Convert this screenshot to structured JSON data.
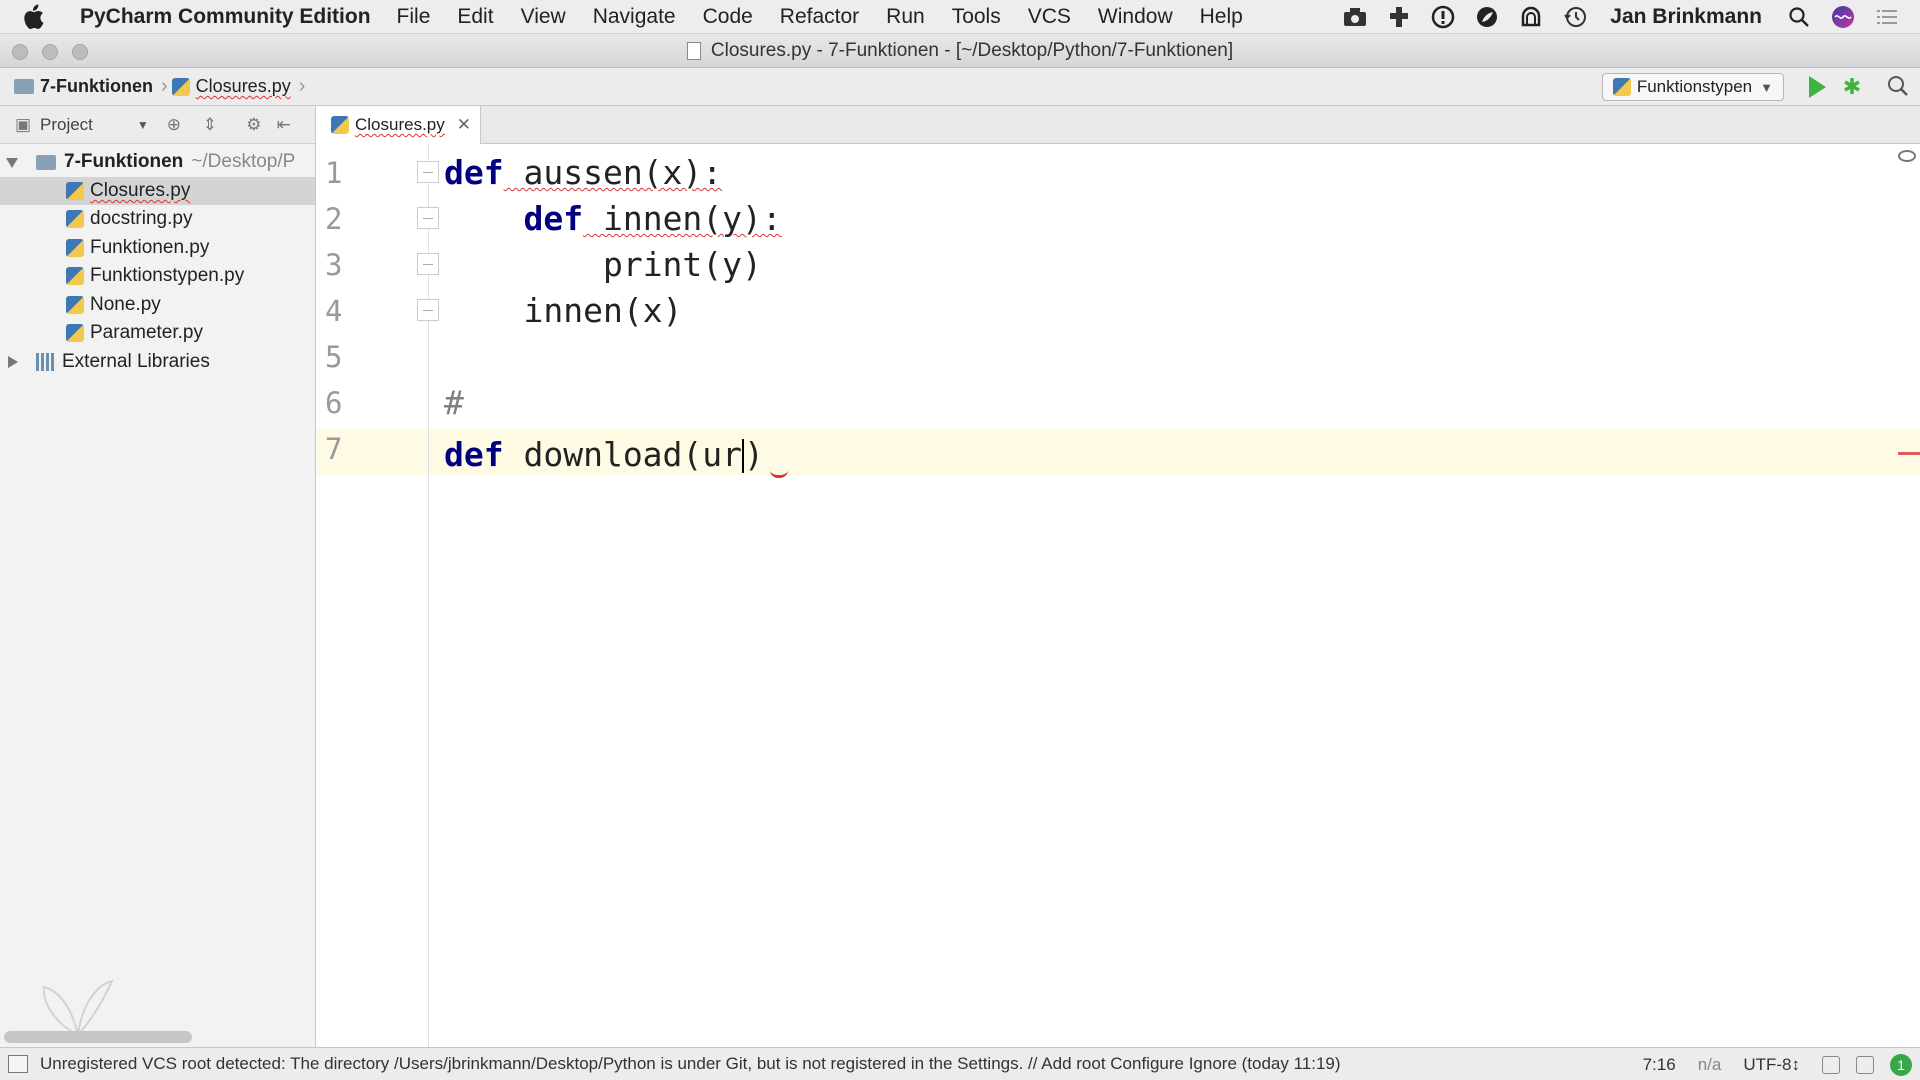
{
  "menubar": {
    "app_name": "PyCharm Community Edition",
    "items": [
      "File",
      "Edit",
      "View",
      "Navigate",
      "Code",
      "Refactor",
      "Run",
      "Tools",
      "VCS",
      "Window",
      "Help"
    ],
    "user": "Jan Brinkmann",
    "tray_icons": [
      "camera-icon",
      "puzzle-icon",
      "info-icon",
      "leaf-icon",
      "bell-icon",
      "time-machine-icon",
      "search-icon",
      "siri-icon",
      "notification-list-icon"
    ]
  },
  "window": {
    "title": "Closures.py - 7-Funktionen - [~/Desktop/Python/7-Funktionen]"
  },
  "navbar": {
    "crumb_project": "7-Funktionen",
    "crumb_file": "Closures.py",
    "run_config": "Funktionstypen"
  },
  "project_panel": {
    "header": "Project",
    "root": {
      "name": "7-Funktionen",
      "path": "~/Desktop/P"
    },
    "files": [
      "Closures.py",
      "docstring.py",
      "Funktionen.py",
      "Funktionstypen.py",
      "None.py",
      "Parameter.py"
    ],
    "selected_file": "Closures.py",
    "external": "External Libraries"
  },
  "editor": {
    "tab": "Closures.py",
    "line_numbers": [
      "1",
      "2",
      "3",
      "4",
      "5",
      "6",
      "7"
    ],
    "lines": [
      {
        "kw": "def",
        "text": " aussen(x):"
      },
      {
        "indent": "    ",
        "kw": "def",
        "text": " innen(y):"
      },
      {
        "indent": "        ",
        "text": "print(y)"
      },
      {
        "indent": "    ",
        "text": "innen(x)"
      },
      {
        "text": ""
      },
      {
        "comment": "#"
      },
      {
        "kw": "def",
        "text": " download(ur",
        "after_caret": ")"
      }
    ],
    "colors": {
      "keyword": "#000080",
      "caret_line": "#fffae3",
      "error": "#d33333"
    }
  },
  "statusbar": {
    "message": "Unregistered VCS root detected: The directory /Users/jbrinkmann/Desktop/Python is under Git, but is not registered in the Settings. // Add root  Configure  Ignore (today 11:19)",
    "position": "7:16",
    "na": "n/a",
    "encoding": "UTF-8↕",
    "notifications": "1"
  }
}
